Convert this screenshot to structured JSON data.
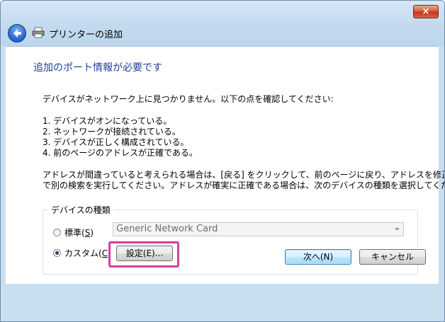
{
  "window": {
    "title": "プリンターの追加",
    "close_label": "×"
  },
  "page": {
    "heading": "追加のポート情報が必要です",
    "intro": "デバイスがネットワーク上に見つかりません。以下の点を確認してください:",
    "checklist": [
      "1.  デバイスがオンになっている。",
      "2.  ネットワークが接続されている。",
      "3.  デバイスが正しく構成されている。",
      "4. 前のページのアドレスが正確である。"
    ],
    "advice_line1": "アドレスが間違っていると考えられる場合は、[戻る] をクリックして、前のページに戻り、アドレスを修正し、ネットワーク",
    "advice_line2": "で別の検索を実行してください。アドレスが確実に正確である場合は、次のデバイスの種類を選択してください。"
  },
  "device_type": {
    "group_label": "デバイスの種類",
    "standard_label": "標準(",
    "standard_key": "S",
    "standard_label_end": ")",
    "custom_label": "カスタム(",
    "custom_key": "C",
    "custom_label_end": ")",
    "selected": "custom",
    "standard_value": "Generic Network Card",
    "settings_label": "設定(E)..."
  },
  "footer": {
    "next_label": "次へ(N)",
    "cancel_label": "キャンセル"
  }
}
